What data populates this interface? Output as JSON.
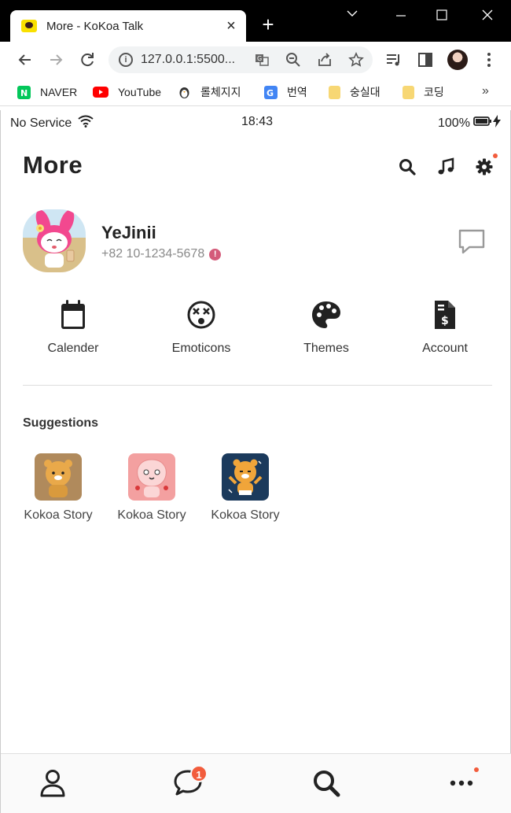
{
  "browser": {
    "tab_title": "More - KoKoa Talk",
    "url": "127.0.0.1:5500...",
    "bookmarks": [
      {
        "label": "NAVER"
      },
      {
        "label": "YouTube"
      },
      {
        "label": "롤체지지"
      },
      {
        "label": "번역"
      },
      {
        "label": "숭실대"
      },
      {
        "label": "코딩"
      }
    ],
    "more_bookmarks": "»"
  },
  "status_bar": {
    "carrier": "No Service",
    "time": "18:43",
    "battery": "100%"
  },
  "header": {
    "title": "More"
  },
  "profile": {
    "name": "YeJinii",
    "phone": "+82 10-1234-5678",
    "warning": "!"
  },
  "menu": [
    {
      "label": "Calender",
      "icon": "calendar-icon"
    },
    {
      "label": "Emoticons",
      "icon": "dizzy-face-icon"
    },
    {
      "label": "Themes",
      "icon": "palette-icon"
    },
    {
      "label": "Account",
      "icon": "invoice-dollar-icon"
    }
  ],
  "suggestions": {
    "title": "Suggestions",
    "items": [
      {
        "label": "Kokoa Story"
      },
      {
        "label": "Kokoa Story"
      },
      {
        "label": "Kokoa Story"
      }
    ]
  },
  "bottom_nav": {
    "chat_badge": "1"
  },
  "colors": {
    "accent_dot": "#f25c3c",
    "warning": "#d45b7a",
    "text": "#222222"
  }
}
